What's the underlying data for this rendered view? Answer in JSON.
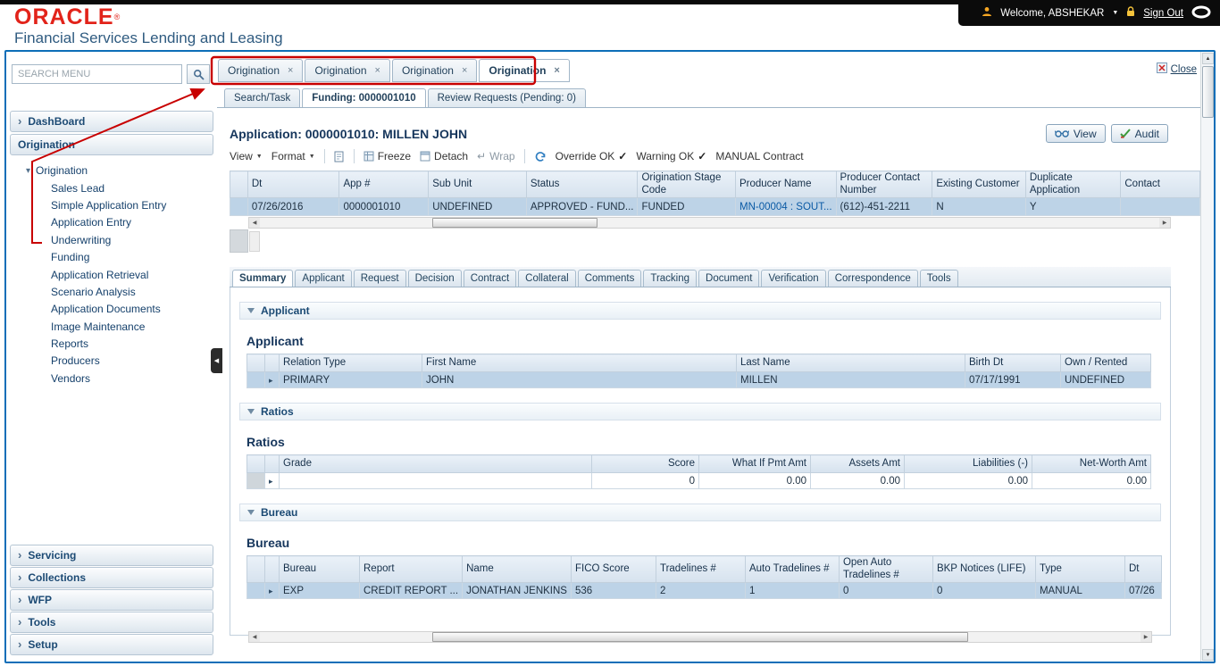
{
  "header": {
    "brand": "ORACLE",
    "reg": "®",
    "subtitle": "Financial Services Lending and Leasing",
    "welcome": "Welcome, ABSHEKAR",
    "sign_out": "Sign Out"
  },
  "sidebar": {
    "search_placeholder": "SEARCH MENU",
    "dashboard": "DashBoard",
    "origination_section": "Origination",
    "tree_root": "Origination",
    "tree_items": [
      "Sales Lead",
      "Simple Application Entry",
      "Application Entry",
      "Underwriting",
      "Funding",
      "Application Retrieval",
      "Scenario Analysis",
      "Application Documents",
      "Image Maintenance",
      "Reports",
      "Producers",
      "Vendors"
    ],
    "bottom_sections": [
      "Servicing",
      "Collections",
      "WFP",
      "Tools",
      "Setup"
    ]
  },
  "tabs": {
    "window_tabs": [
      "Origination",
      "Origination",
      "Origination",
      "Origination"
    ],
    "close_button": "Close",
    "page_tabs": [
      "Search/Task",
      "Funding: 0000001010",
      "Review Requests (Pending: 0)"
    ]
  },
  "main": {
    "title": "Application: 0000001010: MILLEN JOHN",
    "buttons": {
      "view": "View",
      "audit": "Audit"
    },
    "toolbar": {
      "view_menu": "View",
      "format_menu": "Format",
      "freeze": "Freeze",
      "detach": "Detach",
      "wrap": "Wrap",
      "override_ok": "Override OK",
      "warning_ok": "Warning OK",
      "contract_note": "MANUAL Contract"
    },
    "app_grid": {
      "columns": [
        "Dt",
        "App #",
        "Sub Unit",
        "Status",
        "Origination Stage Code",
        "Producer Name",
        "Producer Contact Number",
        "Existing Customer",
        "Duplicate Application",
        "Contact"
      ],
      "row": [
        "07/26/2016",
        "0000001010",
        "UNDEFINED",
        "APPROVED - FUND...",
        "FUNDED",
        "MN-00004 : SOUT...",
        "(612)-451-2211",
        "N",
        "Y",
        ""
      ]
    },
    "detail_tabs": [
      "Summary",
      "Applicant",
      "Request",
      "Decision",
      "Contract",
      "Collateral",
      "Comments",
      "Tracking",
      "Document",
      "Verification",
      "Correspondence",
      "Tools"
    ],
    "applicant": {
      "section": "Applicant",
      "heading": "Applicant",
      "columns": [
        "Relation Type",
        "First Name",
        "Last Name",
        "Birth Dt",
        "Own / Rented"
      ],
      "row": [
        "PRIMARY",
        "JOHN",
        "MILLEN",
        "07/17/1991",
        "UNDEFINED"
      ]
    },
    "ratios": {
      "section": "Ratios",
      "heading": "Ratios",
      "columns": [
        "Grade",
        "Score",
        "What If Pmt Amt",
        "Assets Amt",
        "Liabilities (-)",
        "Net-Worth Amt"
      ],
      "row": [
        "",
        "0",
        "0.00",
        "0.00",
        "0.00",
        "0.00"
      ]
    },
    "bureau": {
      "section": "Bureau",
      "heading": "Bureau",
      "columns": [
        "Bureau",
        "Report",
        "Name",
        "FICO Score",
        "Tradelines #",
        "Auto Tradelines #",
        "Open Auto Tradelines #",
        "BKP Notices (LIFE)",
        "Type",
        "Dt"
      ],
      "row": [
        "EXP",
        "CREDIT REPORT ...",
        "JONATHAN JENKINS",
        "536",
        "2",
        "1",
        "0",
        "0",
        "MANUAL",
        "07/26"
      ]
    }
  }
}
